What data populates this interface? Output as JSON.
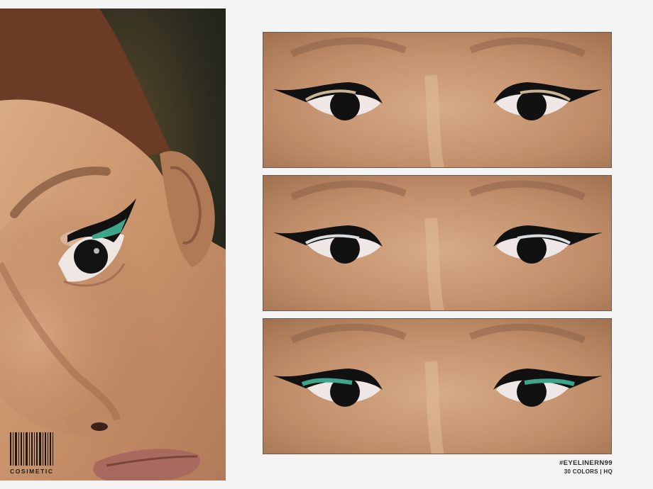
{
  "product": {
    "hashtag": "#EYELINERN99",
    "details": "30 COLORS | HQ"
  },
  "brand": {
    "logo_text": "COSIMETIC"
  },
  "colors": {
    "skin": "#c4946e",
    "skin_light": "#d8ad88",
    "background_dark": "#1e2018",
    "liner_green": "#3fa58a",
    "liner_black": "#111111",
    "lip": "#a86a5f"
  },
  "panels": [
    {
      "variant": "gold-liner"
    },
    {
      "variant": "silver-liner"
    },
    {
      "variant": "green-liner"
    }
  ]
}
